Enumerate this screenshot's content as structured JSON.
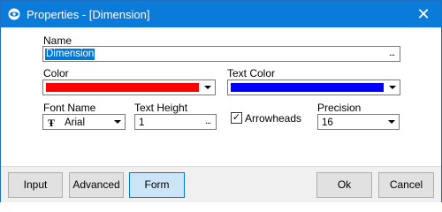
{
  "window": {
    "title": "Properties - [Dimension]",
    "close_glyph": "✕",
    "app_icon": "eye-logo-icon"
  },
  "name": {
    "label": "Name",
    "value": "Dimension",
    "ellipsis": "..."
  },
  "color": {
    "label": "Color",
    "value_hex": "#ff0000"
  },
  "text_color": {
    "label": "Text Color",
    "value_hex": "#0000ff"
  },
  "font_name": {
    "label": "Font Name",
    "icon": "truetype-font-icon",
    "icon_glyph": "Ŧ",
    "value": "Arial"
  },
  "text_height": {
    "label": "Text Height",
    "value": "1",
    "ellipsis": "..."
  },
  "arrowheads": {
    "label": "Arrowheads",
    "checked": true,
    "check_glyph": "✓"
  },
  "precision": {
    "label": "Precision",
    "value": "16"
  },
  "buttons": {
    "input": "Input",
    "advanced": "Advanced",
    "form": "Form",
    "ok": "Ok",
    "cancel": "Cancel"
  }
}
